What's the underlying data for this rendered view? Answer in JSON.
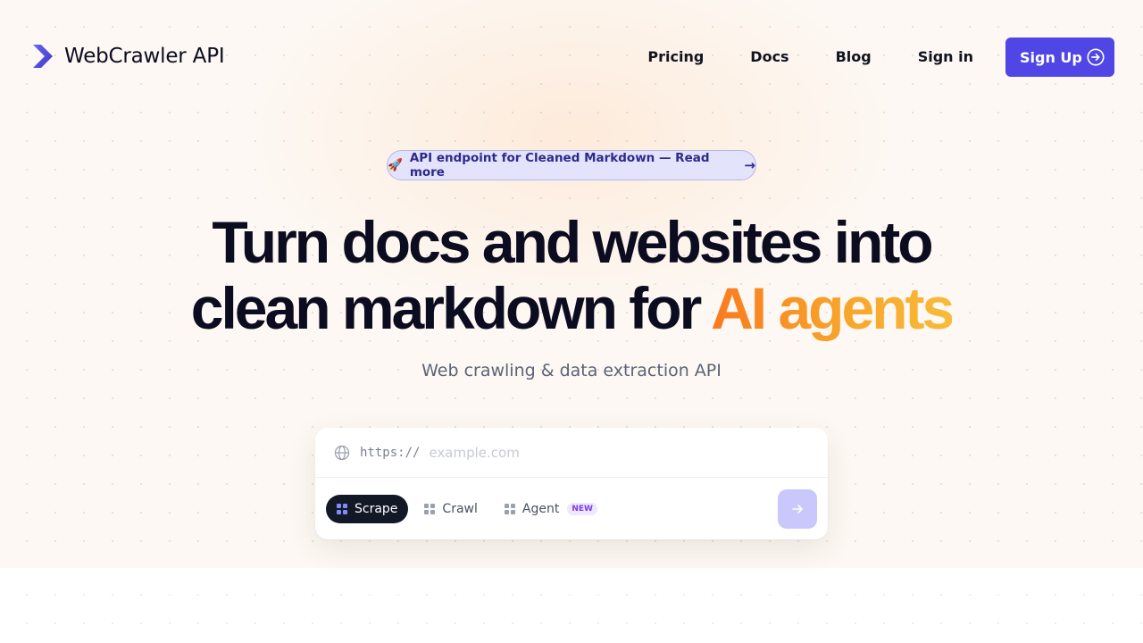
{
  "brand": {
    "name": "WebCrawler API",
    "accent": "#4f46e5"
  },
  "nav": {
    "links": [
      "Pricing",
      "Docs",
      "Blog",
      "Sign in"
    ],
    "signup_label": "Sign Up"
  },
  "announcement": {
    "emoji": "🚀",
    "text": "API endpoint for Cleaned Markdown — Read more",
    "arrow": "→"
  },
  "hero": {
    "line1": "Turn docs and websites into",
    "line2_plain": "clean markdown for ",
    "line2_highlight": "AI agents",
    "subtitle": "Web crawling & data extraction API"
  },
  "search": {
    "prefix": "https://",
    "placeholder": "example.com",
    "value": ""
  },
  "modes": [
    {
      "label": "Scrape",
      "active": true
    },
    {
      "label": "Crawl",
      "active": false
    },
    {
      "label": "Agent",
      "active": false,
      "badge": "NEW"
    }
  ],
  "icons": {
    "logo": "chevron-logo-icon",
    "signup": "arrow-circle-right-icon",
    "globe": "globe-icon",
    "mode": "grid-icon",
    "submit": "arrow-right-icon"
  }
}
